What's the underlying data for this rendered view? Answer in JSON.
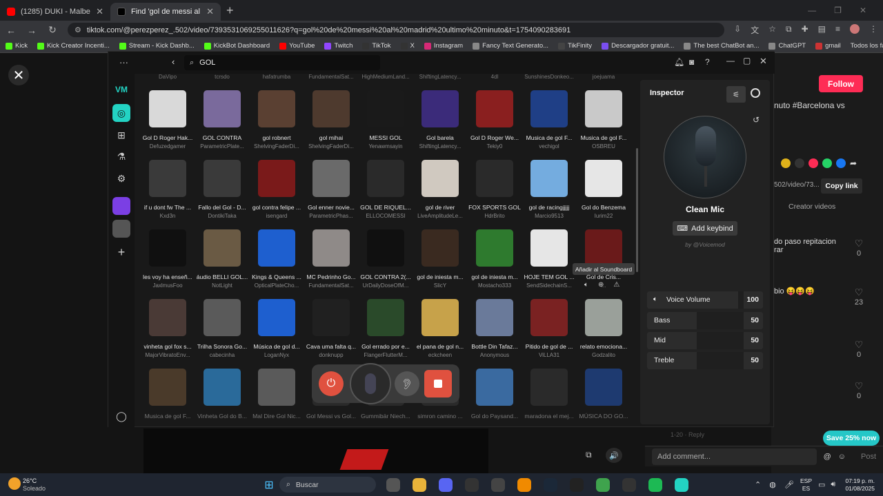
{
  "browser": {
    "tabs": [
      {
        "title": "(1285) DUKI - Malbec x Bizarrap",
        "favicon_color": "#ff0000"
      },
      {
        "title": "Find 'gol de messi al madrid ult",
        "favicon_color": "#000000"
      }
    ],
    "url": "tiktok.com/@perezperez_.502/video/7393531069255011626?q=gol%20de%20messi%20al%20madrid%20ultimo%20minuto&t=1754090283691",
    "bookmarks": [
      "Kick",
      "Kick Creator Incenti...",
      "Stream - Kick Dashb...",
      "KickBot Dashboard",
      "YouTube",
      "Twitch",
      "TikTok",
      "X",
      "Instagram",
      "Fancy Text Generato...",
      "TikFinity",
      "Descargador gratuit...",
      "The best ChatBot an...",
      "ChatGPT",
      "gmail"
    ],
    "all_favorites": "Todos los favoritos"
  },
  "tiktok": {
    "follow": "Follow",
    "caption": "nuto #Barcelona vs",
    "link_frag": "502/video/73...",
    "copy_link": "Copy link",
    "creator_videos": "Creator videos",
    "comment1": "do paso repitacion rar",
    "comment2": "bio 😝😝😝",
    "likes": [
      "0",
      "23",
      "0",
      "0"
    ],
    "save": "Save 25% now",
    "comment_placeholder": "Add comment...",
    "post": "Post",
    "bottom_hint": "1-20 · Reply"
  },
  "voicemod": {
    "search": "GOL",
    "top_partial": [
      "DaVipo",
      "tcrsdo",
      "hafatrumba",
      "FundamentalSat...",
      "HighMediumLand...",
      "ShiftingLatency...",
      "4dl",
      "SunshinesDonkeo...",
      "joejuama"
    ],
    "sounds": [
      [
        [
          "Gol D Roger Hak...",
          "Defuzedgamer"
        ],
        [
          "GOL CONTRA",
          "ParametricPlate..."
        ],
        [
          "gol robnert",
          "ShelvingFaderDi..."
        ],
        [
          "gol mihai",
          "ShelvingFaderDi..."
        ],
        [
          "MESSI GOL",
          "Yenawmsayin"
        ],
        [
          "Gol barela",
          "ShiftingLatency..."
        ],
        [
          "Gol D Roger We...",
          "Tekiy0"
        ],
        [
          "Musica de gol F...",
          "vechigol"
        ],
        [
          "Musica de gol F...",
          "OSBREU"
        ]
      ],
      [
        [
          "if u dont fw The ...",
          "Kxd3n"
        ],
        [
          "Fallo del Gol - D...",
          "DontikiTaka"
        ],
        [
          "gol contra felipe ...",
          "isengard"
        ],
        [
          "Gol enner novie...",
          "ParametricPhas..."
        ],
        [
          "GOL DE RIQUEL...",
          "ELLOCOMESSI"
        ],
        [
          "gol de river",
          "LiveAmplitudeLe..."
        ],
        [
          "FOX SPORTS GOL",
          "HdrBrito"
        ],
        [
          "gol de racingjjjjj",
          "Marcio9513"
        ],
        [
          "Gol do Benzema",
          "Iurim22"
        ]
      ],
      [
        [
          "les voy ha enseñ...",
          "JaxlmusFoo"
        ],
        [
          "áudio BELLI GOL...",
          "NotLight"
        ],
        [
          "Kings & Queens ...",
          "OpticalPlateCho..."
        ],
        [
          "MC Pedrinho Go...",
          "FundamentalSat..."
        ],
        [
          "GOL CONTRA 2(...",
          "UrDailyDoseOfM..."
        ],
        [
          "gol de iniesta m...",
          "SlicY"
        ],
        [
          "gol de iniesta m...",
          "Mostacho333"
        ],
        [
          "HOJE TEM GOL ...",
          "SendSidechainS..."
        ],
        [
          "Gol de Cris...",
          "..."
        ]
      ],
      [
        [
          "vinheta gol fox s...",
          "MajorVibratoEnv..."
        ],
        [
          "Trilha Sonora Go...",
          "cabecinha"
        ],
        [
          "Música de gol d...",
          "LoganNyx"
        ],
        [
          "Cava uma falta q...",
          "donknupp"
        ],
        [
          "Gol errado por e...",
          "FlangerFlutterM..."
        ],
        [
          "el pana de gol n...",
          "eckcheen"
        ],
        [
          "Bottle Din Tafaz...",
          "Anonymous"
        ],
        [
          "Pitido de gol de ...",
          "ViLLA31"
        ],
        [
          "relato emociona...",
          "Godzalito"
        ]
      ],
      [
        [
          "Musica de gol F...",
          ""
        ],
        [
          "Vinheta Gol do B...",
          ""
        ],
        [
          "Mal Dire Gol Nic...",
          ""
        ],
        [
          "Gol Messi vs Gol...",
          ""
        ],
        [
          "Gummibär Niech...",
          ""
        ],
        [
          "simron camino ...",
          ""
        ],
        [
          "Gol do Paysand...",
          ""
        ],
        [
          "maradona el mej...",
          ""
        ],
        [
          "MÚSICA DO GO...",
          ""
        ]
      ]
    ],
    "thumb_colors": [
      [
        "#d9d9d9",
        "#7a6a9c",
        "#5a4032",
        "#4e3a2e",
        "#1a1a1a",
        "#3b2b7a",
        "#8a1f1f",
        "#1f3f86",
        "#c9c9c9"
      ],
      [
        "#3a3a3a",
        "#3a3a3a",
        "#7a1a1a",
        "#6a6a6a",
        "#2a2a2a",
        "#d0c9c0",
        "#2a2a2a",
        "#74acdf",
        "#e6e6e6"
      ],
      [
        "#101010",
        "#6a5a44",
        "#1e5fcf",
        "#8f8a88",
        "#101010",
        "#3a2a20",
        "#2e7a2e",
        "#e6e6e6",
        "#6a1a1a"
      ],
      [
        "#4a3a36",
        "#5a5a5a",
        "#1e5fcf",
        "#202020",
        "#2a4a2a",
        "#c7a24a",
        "#6a7a9a",
        "#7a2222",
        "#9aa09a"
      ],
      [
        "#4a3a2a",
        "#2a6a9a",
        "#5a5a5a",
        "#2a2a2a",
        "#2a2a2a",
        "#2a2a2a",
        "#3a6aa0",
        "#2a2a2a",
        "#1e3a70"
      ]
    ],
    "tooltip": "Añadir al Soundboard",
    "inspector": {
      "title": "Inspector",
      "voice_name": "Clean Mic",
      "add_keybind": "Add keybind",
      "by": "by @Voicemod",
      "sliders": [
        {
          "label": "Voice Volume",
          "value": 100
        },
        {
          "label": "Bass",
          "value": 50
        },
        {
          "label": "Mid",
          "value": 50
        },
        {
          "label": "Treble",
          "value": 50
        }
      ]
    },
    "accent": "#23d3c3"
  },
  "taskbar": {
    "weather_temp": "26°C",
    "weather_desc": "Soleado",
    "search": "Buscar",
    "lang1": "ESP",
    "lang2": "ES",
    "time": "07:19 p. m.",
    "date": "01/08/2025"
  }
}
